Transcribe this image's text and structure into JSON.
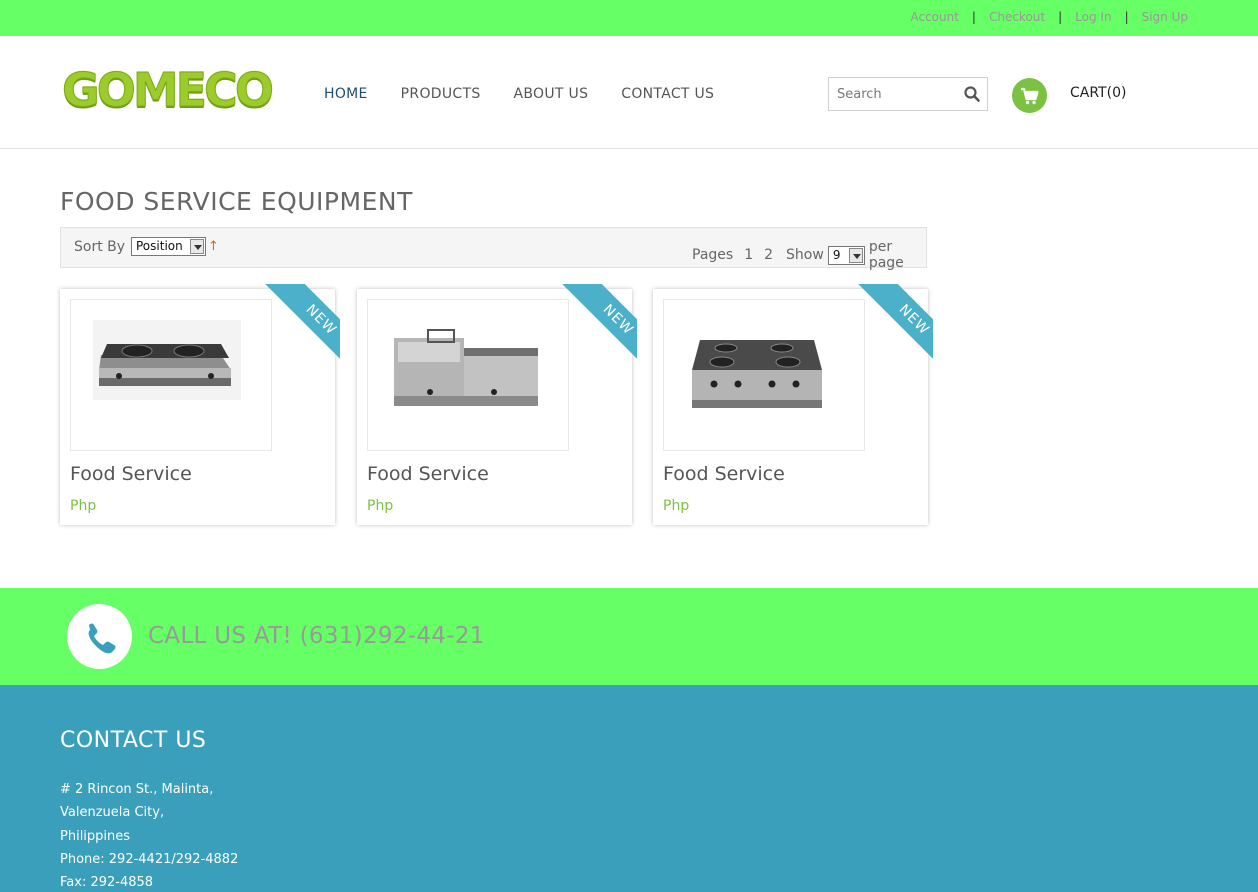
{
  "top_links": [
    "Account",
    "Checkout",
    "Log In",
    "Sign Up"
  ],
  "logo": {
    "text": "GOMECO"
  },
  "nav": [
    {
      "label": "HOME",
      "active": true
    },
    {
      "label": "PRODUCTS",
      "active": false
    },
    {
      "label": "ABOUT US",
      "active": false
    },
    {
      "label": "CONTACT US",
      "active": false
    }
  ],
  "search": {
    "placeholder": "Search",
    "icon": "search-icon"
  },
  "cart": {
    "label": "CART(0)",
    "icon": "shopping-cart-icon"
  },
  "page_title": "FOOD SERVICE EQUIPMENT",
  "toolbar": {
    "sort_by_label": "Sort By",
    "sort_value": "Position",
    "sort_direction_icon": "↑",
    "pages_label": "Pages",
    "pages": [
      "1",
      "2"
    ],
    "show_label": "Show",
    "show_value": "9",
    "per_page_label": "per page"
  },
  "products": [
    {
      "name": "Food Service",
      "price": "Php",
      "badge": "NEW",
      "image": "double-burner-stove"
    },
    {
      "name": "Food Service",
      "price": "Php",
      "badge": "NEW",
      "image": "fryer-griddle-combo"
    },
    {
      "name": "Food Service",
      "price": "Php",
      "badge": "NEW",
      "image": "four-burner-range"
    }
  ],
  "call_bar": {
    "text": "CALL US AT! (631)292-44-21",
    "icon": "phone-icon"
  },
  "footer": {
    "heading": "CONTACT US",
    "address_lines": [
      "# 2 Rincon St., Malinta,",
      "Valenzuela City,",
      "Philippines",
      "Phone: 292-4421/292-4882",
      "Fax: 292-4858"
    ]
  },
  "colors": {
    "top_bar": "#66ff66",
    "accent_green": "#7cc242",
    "ribbon_blue": "#4bb0c9",
    "footer_bg": "#3a9fba",
    "nav_active": "#1e4e73"
  }
}
